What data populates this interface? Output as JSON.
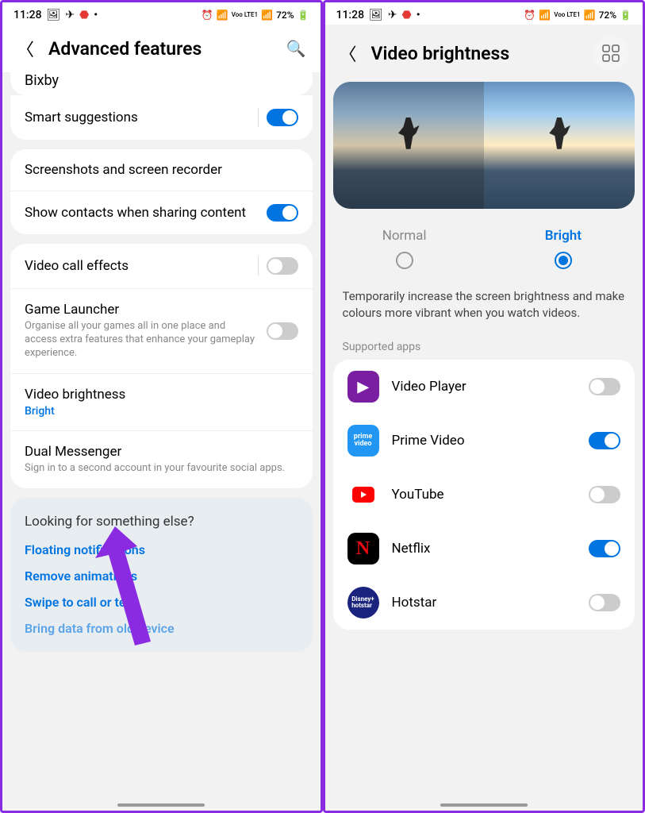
{
  "status": {
    "time": "11:28",
    "battery": "72%",
    "network": "Voo LTE1"
  },
  "left": {
    "title": "Advanced features",
    "bixby": "Bixby",
    "smart_suggestions": "Smart suggestions",
    "screenshots": "Screenshots and screen recorder",
    "show_contacts": "Show contacts when sharing content",
    "video_call": "Video call effects",
    "game_launcher": {
      "title": "Game Launcher",
      "sub": "Organise all your games all in one place and access extra features that enhance your gameplay experience."
    },
    "video_brightness": {
      "title": "Video brightness",
      "value": "Bright"
    },
    "dual_messenger": {
      "title": "Dual Messenger",
      "sub": "Sign in to a second account in your favourite social apps."
    },
    "help": {
      "title": "Looking for something else?",
      "links": [
        "Floating notifications",
        "Remove animations",
        "Swipe to call or text",
        "Bring data from old device"
      ]
    }
  },
  "right": {
    "title": "Video brightness",
    "normal": "Normal",
    "bright": "Bright",
    "description": "Temporarily increase the screen brightness and make colours more vibrant when you watch videos.",
    "supported": "Supported apps",
    "apps": [
      {
        "name": "Video Player",
        "on": false,
        "bg": "#7b1fa2",
        "icon": "▶"
      },
      {
        "name": "Prime Video",
        "on": true,
        "bg": "#2196f3",
        "icon": "pv"
      },
      {
        "name": "YouTube",
        "on": false,
        "bg": "#fff",
        "icon": "yt"
      },
      {
        "name": "Netflix",
        "on": true,
        "bg": "#000",
        "icon": "N"
      },
      {
        "name": "Hotstar",
        "on": false,
        "bg": "#1a237e",
        "icon": "D+"
      }
    ]
  }
}
